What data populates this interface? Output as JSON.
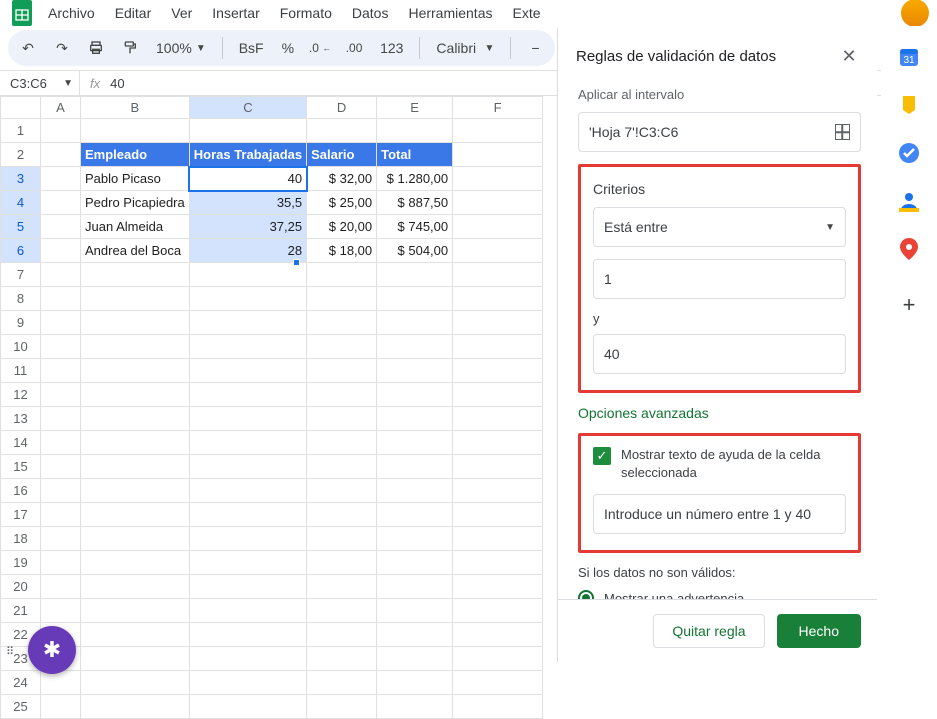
{
  "menu": {
    "archivo": "Archivo",
    "editar": "Editar",
    "ver": "Ver",
    "insertar": "Insertar",
    "formato": "Formato",
    "datos": "Datos",
    "herramientas": "Herramientas",
    "extensiones": "Exte"
  },
  "toolbar": {
    "zoom": "100%",
    "currency": "BsF",
    "percent": "%",
    "decdec": ".0",
    "incdec": ".00",
    "num123": "123",
    "font": "Calibri"
  },
  "namebox": "C3:C6",
  "formula": "40",
  "columns": [
    "A",
    "B",
    "C",
    "D",
    "E",
    "F"
  ],
  "headers": {
    "empleado": "Empleado",
    "horas": "Horas Trabajadas",
    "salario": "Salario",
    "total": "Total"
  },
  "rows": [
    {
      "empleado": "Pablo Picaso",
      "horas": "40",
      "salario": "$ 32,00",
      "total": "$ 1.280,00"
    },
    {
      "empleado": "Pedro Picapiedra",
      "horas": "35,5",
      "salario": "$ 25,00",
      "total": "$ 887,50"
    },
    {
      "empleado": "Juan Almeida",
      "horas": "37,25",
      "salario": "$ 20,00",
      "total": "$ 745,00"
    },
    {
      "empleado": "Andrea del Boca",
      "horas": "28",
      "salario": "$ 18,00",
      "total": "$ 504,00"
    }
  ],
  "sidepanel": {
    "title": "Reglas de validación de datos",
    "apply_label": "Aplicar al intervalo",
    "range": "'Hoja 7'!C3:C6",
    "criteria_label": "Criterios",
    "criteria_select": "Está entre",
    "min": "1",
    "and": "y",
    "max": "40",
    "advanced": "Opciones avanzadas",
    "help_check": "Mostrar texto de ayuda de la celda seleccionada",
    "help_text": "Introduce un número entre 1 y 40",
    "invalid_label": "Si los datos no son válidos:",
    "invalid_warn": "Mostrar una advertencia",
    "remove_btn": "Quitar regla",
    "done_btn": "Hecho"
  }
}
